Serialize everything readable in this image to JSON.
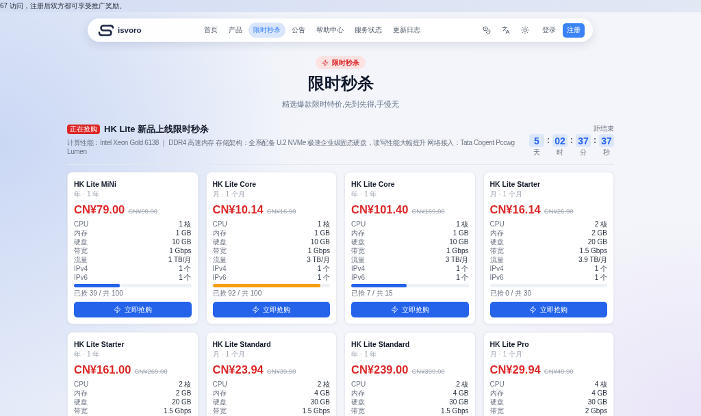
{
  "announcement": {
    "text": "67 访问，注册后双方都可享受推广奖励。"
  },
  "nav": {
    "brand": "isvoro",
    "links": [
      {
        "label": "首页",
        "selected": false
      },
      {
        "label": "产品",
        "selected": false
      },
      {
        "label": "限时秒杀",
        "selected": true
      },
      {
        "label": "公告",
        "selected": false
      },
      {
        "label": "帮助中心",
        "selected": false
      },
      {
        "label": "服务状态",
        "selected": false
      },
      {
        "label": "更新日志",
        "selected": false
      }
    ],
    "login": "登录",
    "register": "注册"
  },
  "hero": {
    "badge": "限时秒杀",
    "title": "限时秒杀",
    "subtitle": "精选爆款限时特价,先到先得,手慢无"
  },
  "sale": {
    "status": "正在抢购",
    "title": "HK Lite 新品上线限时秒杀",
    "description": "计算性能：Intel Xeon Gold 6138 ｜ DDR4 高速内存 存储架构：全系配备 U.2 NVMe 极速企业级固态硬盘，读写性能大幅提升 网络接入：Tata Cogent Pccwg Lumen",
    "countdown": {
      "label": "距结束",
      "units": [
        {
          "value": "5",
          "unit": "天"
        },
        {
          "separator": ":",
          "value": "02",
          "unit": "时"
        },
        {
          "separator": ":",
          "value": "37",
          "unit": "分"
        },
        {
          "separator": ":",
          "value": "37",
          "unit": "秒"
        }
      ]
    }
  },
  "products": [
    {
      "name": "HK Lite MiNi",
      "term": "年 · 1 年",
      "price": "CN¥79.00",
      "original_price": "CN¥99.00",
      "specs": [
        {
          "label": "CPU",
          "value": "1 核"
        },
        {
          "label": "内存",
          "value": "1 GB"
        },
        {
          "label": "硬盘",
          "value": "10 GB"
        },
        {
          "label": "带宽",
          "value": "1 Gbps"
        },
        {
          "label": "流量",
          "value": "1 TB/月"
        },
        {
          "label": "IPv4",
          "value": "1 个"
        },
        {
          "label": "IPv6",
          "value": "1 个"
        }
      ],
      "stock": {
        "text": "已抢 39 / 共 100",
        "level": 0.39
      },
      "button": "立即抢购"
    },
    {
      "name": "HK Lite Core",
      "term": "月 · 1 个月",
      "price": "CN¥10.14",
      "original_price": "CN¥16.90",
      "specs": [
        {
          "label": "CPU",
          "value": "1 核"
        },
        {
          "label": "内存",
          "value": "1 GB"
        },
        {
          "label": "硬盘",
          "value": "10 GB"
        },
        {
          "label": "带宽",
          "value": "1 Gbps"
        },
        {
          "label": "流量",
          "value": "3 TB/月"
        },
        {
          "label": "IPv4",
          "value": "1 个"
        },
        {
          "label": "IPv6",
          "value": "1 个"
        }
      ],
      "stock": {
        "text": "已抢 92 / 共 100",
        "level": 0.92
      },
      "button": "立即抢购"
    },
    {
      "name": "HK Lite Core",
      "term": "年 · 1 年",
      "price": "CN¥101.40",
      "original_price": "CN¥169.00",
      "specs": [
        {
          "label": "CPU",
          "value": "1 核"
        },
        {
          "label": "内存",
          "value": "1 GB"
        },
        {
          "label": "硬盘",
          "value": "10 GB"
        },
        {
          "label": "带宽",
          "value": "1 Gbps"
        },
        {
          "label": "流量",
          "value": "3 TB/月"
        },
        {
          "label": "IPv4",
          "value": "1 个"
        },
        {
          "label": "IPv6",
          "value": "1 个"
        }
      ],
      "stock": {
        "text": "已抢 7 / 共 15",
        "level": 0.47
      },
      "button": "立即抢购"
    },
    {
      "name": "HK Lite Starter",
      "term": "月 · 1 个月",
      "price": "CN¥16.14",
      "original_price": "CN¥26.90",
      "specs": [
        {
          "label": "CPU",
          "value": "2 核"
        },
        {
          "label": "内存",
          "value": "2 GB"
        },
        {
          "label": "硬盘",
          "value": "20 GB"
        },
        {
          "label": "带宽",
          "value": "1.5 Gbps"
        },
        {
          "label": "流量",
          "value": "3.9 TB/月"
        },
        {
          "label": "IPv4",
          "value": "1 个"
        },
        {
          "label": "IPv6",
          "value": "1 个"
        }
      ],
      "stock": {
        "text": "已抢 0 / 共 30",
        "level": 0
      },
      "button": "立即抢购"
    },
    {
      "name": "HK Lite Starter",
      "term": "年 · 1 年",
      "price": "CN¥161.00",
      "original_price": "CN¥269.00",
      "specs": [
        {
          "label": "CPU",
          "value": "2 核"
        },
        {
          "label": "内存",
          "value": "2 GB"
        },
        {
          "label": "硬盘",
          "value": "20 GB"
        },
        {
          "label": "带宽",
          "value": "1.5 Gbps"
        }
      ]
    },
    {
      "name": "HK Lite Standard",
      "term": "月 · 1 个月",
      "price": "CN¥23.94",
      "original_price": "CN¥39.90",
      "specs": [
        {
          "label": "CPU",
          "value": "2 核"
        },
        {
          "label": "内存",
          "value": "4 GB"
        },
        {
          "label": "硬盘",
          "value": "30 GB"
        },
        {
          "label": "带宽",
          "value": "1.5 Gbps"
        }
      ]
    },
    {
      "name": "HK Lite Standard",
      "term": "年 · 1 年",
      "price": "CN¥239.00",
      "original_price": "CN¥399.00",
      "specs": [
        {
          "label": "CPU",
          "value": "2 核"
        },
        {
          "label": "内存",
          "value": "4 GB"
        },
        {
          "label": "硬盘",
          "value": "30 GB"
        },
        {
          "label": "带宽",
          "value": "1.5 Gbps"
        }
      ]
    },
    {
      "name": "HK Lite Pro",
      "term": "月 · 1 个月",
      "price": "CN¥29.94",
      "original_price": "CN¥49.90",
      "specs": [
        {
          "label": "CPU",
          "value": "4 核"
        },
        {
          "label": "内存",
          "value": "4 GB"
        },
        {
          "label": "硬盘",
          "value": "30 GB"
        },
        {
          "label": "带宽",
          "value": "2 Gbps"
        }
      ]
    }
  ]
}
